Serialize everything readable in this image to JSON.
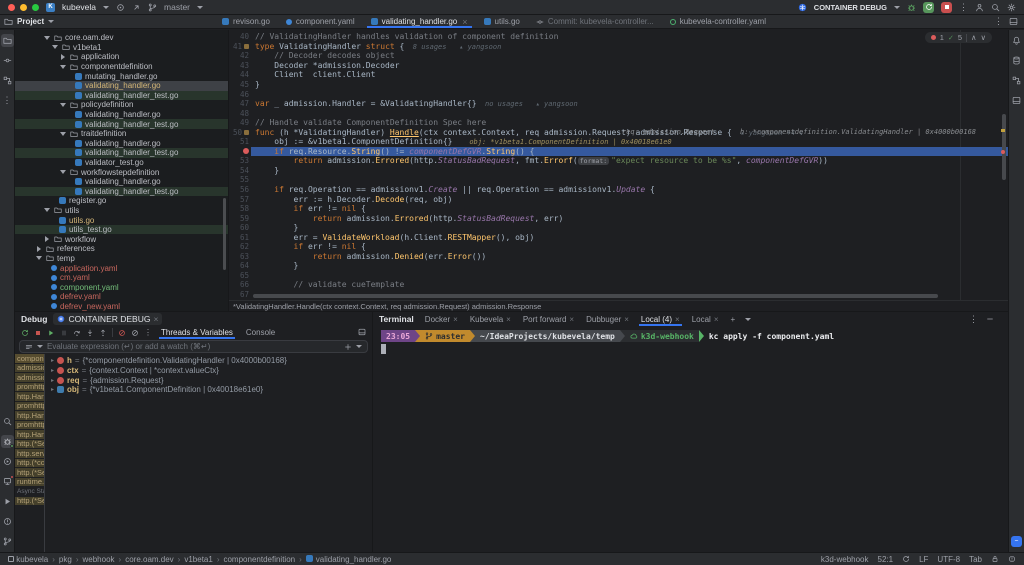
{
  "titlebar": {
    "project": "kubevela",
    "branch": "master",
    "run_config": "CONTAINER DEBUG"
  },
  "tabbar": {
    "project_label": "Project",
    "tabs": [
      {
        "label": "revison.go",
        "icon": "go"
      },
      {
        "label": "component.yaml",
        "icon": "yaml-blue"
      },
      {
        "label": "validating_handler.go",
        "icon": "go",
        "active": true,
        "close": true
      },
      {
        "label": "utils.go",
        "icon": "go"
      },
      {
        "label": "Commit: kubevela-controller...",
        "icon": "commit",
        "dim": true
      },
      {
        "label": "kubevela-controller.yaml",
        "icon": "yaml-green"
      }
    ]
  },
  "left_strip": {
    "top": [
      "project-folder",
      "commit",
      "structure",
      "more"
    ],
    "bottom": [
      "search",
      "debug",
      "run",
      "services",
      "play",
      "problems",
      "version-control"
    ]
  },
  "right_strip": {
    "top": [
      "notifications",
      "database",
      "dependencies",
      "layout"
    ],
    "bottom": [
      "ai-assistant"
    ]
  },
  "project": {
    "tree": [
      {
        "l": "core.oam.dev",
        "t": "fo",
        "i": 2
      },
      {
        "l": "v1beta1",
        "t": "fo",
        "i": 3
      },
      {
        "l": "application",
        "t": "fc",
        "i": 4
      },
      {
        "l": "componentdefinition",
        "t": "fo",
        "i": 4
      },
      {
        "l": "mutating_handler.go",
        "t": "go",
        "i": 5
      },
      {
        "l": "validating_handler.go",
        "t": "go",
        "i": 5,
        "row": "sel",
        "cls": "mod"
      },
      {
        "l": "validating_handler_test.go",
        "t": "go",
        "i": 5,
        "row": "test"
      },
      {
        "l": "policydefinition",
        "t": "fo",
        "i": 4
      },
      {
        "l": "validating_handler.go",
        "t": "go",
        "i": 5
      },
      {
        "l": "validating_handler_test.go",
        "t": "go",
        "i": 5,
        "row": "test"
      },
      {
        "l": "traitdefinition",
        "t": "fo",
        "i": 4
      },
      {
        "l": "validating_handler.go",
        "t": "go",
        "i": 5
      },
      {
        "l": "validating_handler_test.go",
        "t": "go",
        "i": 5,
        "row": "test"
      },
      {
        "l": "validator_test.go",
        "t": "go",
        "i": 5
      },
      {
        "l": "workflowstepdefinition",
        "t": "fo",
        "i": 4
      },
      {
        "l": "validating_handler.go",
        "t": "go",
        "i": 5
      },
      {
        "l": "validating_handler_test.go",
        "t": "go",
        "i": 5,
        "row": "test"
      },
      {
        "l": "register.go",
        "t": "go",
        "i": 3
      },
      {
        "l": "utils",
        "t": "fo",
        "i": 2
      },
      {
        "l": "utils.go",
        "t": "go",
        "i": 3,
        "cls": "mod"
      },
      {
        "l": "utils_test.go",
        "t": "go",
        "i": 3,
        "row": "test"
      },
      {
        "l": "workflow",
        "t": "fc",
        "i": 2
      },
      {
        "l": "references",
        "t": "fc",
        "i": 1
      },
      {
        "l": "temp",
        "t": "fo",
        "i": 1
      },
      {
        "l": "application.yaml",
        "t": "yml",
        "i": 2,
        "cls": "untracked"
      },
      {
        "l": "cm.yaml",
        "t": "yml",
        "i": 2,
        "cls": "untracked"
      },
      {
        "l": "component.yaml",
        "t": "yml",
        "i": 2,
        "cls": "added"
      },
      {
        "l": "defrev.yaml",
        "t": "yml",
        "i": 2,
        "cls": "untracked"
      },
      {
        "l": "defrev_new.yaml",
        "t": "yml",
        "i": 2,
        "cls": "untracked"
      }
    ]
  },
  "editor": {
    "inspections": {
      "errors": "1",
      "ok": "5"
    },
    "context_bar": "*ValidatingHandler.Handle(ctx context.Context, req admission.Request) admission.Response",
    "lines": [
      {
        "n": 40,
        "t": [
          [
            "c",
            "// ValidatingHandler handles validation of component definition"
          ]
        ]
      },
      {
        "n": 41,
        "g": true,
        "t": [
          [
            "k",
            "type "
          ],
          [
            "d",
            "ValidatingHandler "
          ],
          [
            "k",
            "struct "
          ],
          [
            "d",
            "{"
          ],
          [
            "h",
            "  8 usages"
          ],
          [
            "ha",
            "   ▴ yangsoon"
          ]
        ]
      },
      {
        "n": 42,
        "t": [
          [
            "c",
            "    // Decoder decodes object"
          ]
        ]
      },
      {
        "n": 43,
        "t": [
          [
            "d",
            "    Decoder *admission.Decoder"
          ]
        ]
      },
      {
        "n": 44,
        "t": [
          [
            "d",
            "    Client  client.Client"
          ]
        ]
      },
      {
        "n": 45,
        "t": [
          [
            "d",
            "}"
          ]
        ]
      },
      {
        "n": 46,
        "t": []
      },
      {
        "n": 47,
        "t": [
          [
            "k",
            "var "
          ],
          [
            "d",
            "_ admission.Handler = &ValidatingHandler{}"
          ],
          [
            "h",
            "  no usages"
          ],
          [
            "ha",
            "   ▴ yangsoon"
          ]
        ]
      },
      {
        "n": 48,
        "t": []
      },
      {
        "n": 49,
        "t": [
          [
            "c",
            "// Handle validate ComponentDefinition Spec here"
          ]
        ]
      },
      {
        "n": 50,
        "g": true,
        "rh": "req: admission.Request      h: *componentdefinition.ValidatingHandler | 0x4000b00168      ctx: context.C",
        "t": [
          [
            "k",
            "func "
          ],
          [
            "d",
            "(h *ValidatingHandler) "
          ],
          [
            "fu",
            "Handle"
          ],
          [
            "d",
            "(ctx context.Context, req admission.Request) admission.Response {"
          ],
          [
            "ha",
            "  ▴ yangsoon +4 ∨"
          ]
        ]
      },
      {
        "n": 51,
        "t": [
          [
            "d",
            "    obj := &v1beta1.ComponentDefinition{}"
          ],
          [
            "dv",
            "    obj: *v1beta1.ComponentDefinition | 0x40018e61e0"
          ]
        ]
      },
      {
        "n": 52,
        "bp": true,
        "cur": true,
        "t": [
          [
            "d",
            "    "
          ],
          [
            "k",
            "if "
          ],
          [
            "d",
            "req.Resource."
          ],
          [
            "f",
            "String"
          ],
          [
            "d",
            "() != "
          ],
          [
            "v",
            "componentDefGVR"
          ],
          [
            "d",
            "."
          ],
          [
            "f",
            "String"
          ],
          [
            "d",
            "() {"
          ]
        ]
      },
      {
        "n": 53,
        "t": [
          [
            "d",
            "        "
          ],
          [
            "k",
            "return "
          ],
          [
            "d",
            "admission."
          ],
          [
            "f",
            "Errored"
          ],
          [
            "d",
            "(http."
          ],
          [
            "v",
            "StatusBadRequest"
          ],
          [
            "d",
            ", fmt."
          ],
          [
            "f",
            "Errorf"
          ],
          [
            "d",
            "("
          ],
          [
            "pill",
            "format:"
          ],
          [
            "s",
            "\"expect resource to be %s\""
          ],
          [
            "d",
            ", "
          ],
          [
            "v",
            "componentDefGVR"
          ],
          [
            "d",
            "))"
          ]
        ]
      },
      {
        "n": 54,
        "t": [
          [
            "d",
            "    }"
          ]
        ]
      },
      {
        "n": 55,
        "t": []
      },
      {
        "n": 56,
        "t": [
          [
            "d",
            "    "
          ],
          [
            "k",
            "if "
          ],
          [
            "d",
            "req.Operation == admissionv1."
          ],
          [
            "v",
            "Create"
          ],
          [
            "d",
            " || req.Operation == admissionv1."
          ],
          [
            "v",
            "Update"
          ],
          [
            "d",
            " {"
          ]
        ]
      },
      {
        "n": 57,
        "t": [
          [
            "d",
            "        err := h.Decoder."
          ],
          [
            "f",
            "Decode"
          ],
          [
            "d",
            "(req, obj)"
          ]
        ]
      },
      {
        "n": 58,
        "t": [
          [
            "d",
            "        "
          ],
          [
            "k",
            "if "
          ],
          [
            "d",
            "err != "
          ],
          [
            "k",
            "nil"
          ],
          [
            "d",
            " {"
          ]
        ]
      },
      {
        "n": 59,
        "t": [
          [
            "d",
            "            "
          ],
          [
            "k",
            "return "
          ],
          [
            "d",
            "admission."
          ],
          [
            "f",
            "Errored"
          ],
          [
            "d",
            "(http."
          ],
          [
            "v",
            "StatusBadRequest"
          ],
          [
            "d",
            ", err)"
          ]
        ]
      },
      {
        "n": 60,
        "t": [
          [
            "d",
            "        }"
          ]
        ]
      },
      {
        "n": 61,
        "t": [
          [
            "d",
            "        err = "
          ],
          [
            "f",
            "ValidateWorkload"
          ],
          [
            "d",
            "(h.Client."
          ],
          [
            "f",
            "RESTMapper"
          ],
          [
            "d",
            "(), obj)"
          ]
        ]
      },
      {
        "n": 62,
        "t": [
          [
            "d",
            "        "
          ],
          [
            "k",
            "if "
          ],
          [
            "d",
            "err != "
          ],
          [
            "k",
            "nil"
          ],
          [
            "d",
            " {"
          ]
        ]
      },
      {
        "n": 63,
        "t": [
          [
            "d",
            "            "
          ],
          [
            "k",
            "return "
          ],
          [
            "d",
            "admission."
          ],
          [
            "f",
            "Denied"
          ],
          [
            "d",
            "(err."
          ],
          [
            "f",
            "Error"
          ],
          [
            "d",
            "())"
          ]
        ]
      },
      {
        "n": 64,
        "t": [
          [
            "d",
            "        }"
          ]
        ]
      },
      {
        "n": 65,
        "t": []
      },
      {
        "n": 66,
        "t": [
          [
            "c",
            "        // validate cueTemplate"
          ]
        ]
      },
      {
        "n": 67,
        "t": [
          [
            "d",
            "        "
          ]
        ]
      }
    ]
  },
  "debug": {
    "panel_label": "Debug",
    "session_tab": "CONTAINER DEBUG",
    "tabs": [
      "Threads & Variables",
      "Console"
    ],
    "evaluate_placeholder": "Evaluate expression (↵) or add a watch (⌘↵)",
    "frames": [
      {
        "label": "compone",
        "sel": true
      },
      {
        "label": "admissio"
      },
      {
        "label": "admissio"
      },
      {
        "label": "promhttp"
      },
      {
        "label": "http.Han"
      },
      {
        "label": "promhttp"
      },
      {
        "label": "http.Han"
      },
      {
        "label": "promhttp"
      },
      {
        "label": "http.Han"
      },
      {
        "label": "http.(*Se"
      },
      {
        "label": "http.serv"
      },
      {
        "label": "http.(*co"
      },
      {
        "label": "http.(*Se"
      },
      {
        "label": "runtime.("
      },
      {
        "label": "Async Sta",
        "hdr": true
      },
      {
        "label": "http.(*Se"
      }
    ],
    "variables": [
      {
        "icon": "p",
        "name": "h",
        "value": "{*componentdefinition.ValidatingHandler | 0x4000b00168}"
      },
      {
        "icon": "p",
        "name": "ctx",
        "value": "{context.Context | *context.valueCtx}"
      },
      {
        "icon": "p",
        "name": "req",
        "value": "{admission.Request}"
      },
      {
        "icon": "v",
        "name": "obj",
        "value": "{*v1beta1.ComponentDefinition | 0x40018e61e0}"
      }
    ]
  },
  "terminal": {
    "panel_label": "Terminal",
    "tabs": [
      {
        "label": "Docker"
      },
      {
        "label": "Kubevela"
      },
      {
        "label": "Port forward"
      },
      {
        "label": "Dubbuger"
      },
      {
        "label": "Local (4)",
        "active": true
      },
      {
        "label": "Local"
      }
    ],
    "prompt": {
      "segments": [
        {
          "text": "23:05",
          "bg": "#6E4587",
          "fg": "#E8A7D6"
        },
        {
          "text": "master",
          "icon": "branch",
          "bg": "#C18A2D",
          "fg": "#2B2D30"
        },
        {
          "text": "~/IdeaProjects/kubevela/temp",
          "bg": "#45484D",
          "fg": "#DFE1E5"
        },
        {
          "text": "k3d-webhook",
          "icon": "cloud",
          "bg": "#2B2D30",
          "fg": "#57B366",
          "arrow": "#57B366"
        }
      ],
      "command": "kc apply -f component.yaml"
    }
  },
  "statusbar": {
    "breadcrumbs": [
      "kubevela",
      "pkg",
      "webhook",
      "core.oam.dev",
      "v1beta1",
      "componentdefinition",
      "validating_handler.go"
    ],
    "right": [
      "k3d-webhook",
      "52:1",
      "LF",
      "UTF-8",
      "Tab"
    ]
  }
}
